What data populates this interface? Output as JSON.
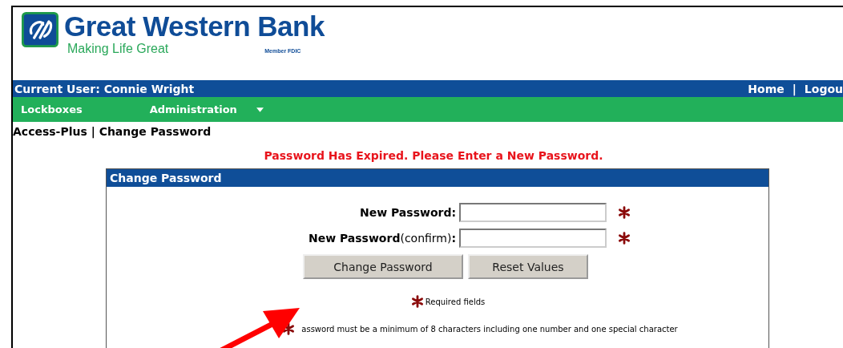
{
  "brand": {
    "name": "Great Western Bank",
    "tagline": "Making Life Great",
    "member": "Member FDIC"
  },
  "user_bar": {
    "user": "Current User: Connie Wright",
    "links": [
      "Home",
      "Logou"
    ],
    "separator": "|"
  },
  "menu": [
    {
      "label": "Lockboxes",
      "dropdown": false
    },
    {
      "label": "Administration",
      "dropdown": true
    }
  ],
  "breadcrumb": "Access-Plus | Change Password",
  "alert": "Password Has Expired. Please Enter a New Password.",
  "panel": {
    "title": "Change Password",
    "fields": [
      {
        "label": "**New Password:**",
        "required": true
      },
      {
        "label": "**New Password**(confirm)**:**",
        "required": true
      }
    ],
    "buttons": [
      "Change Password",
      "Reset Values"
    ],
    "required_note": "Required fields",
    "rule": "assword must be a minimum of 8 characters including one number and one special character"
  }
}
